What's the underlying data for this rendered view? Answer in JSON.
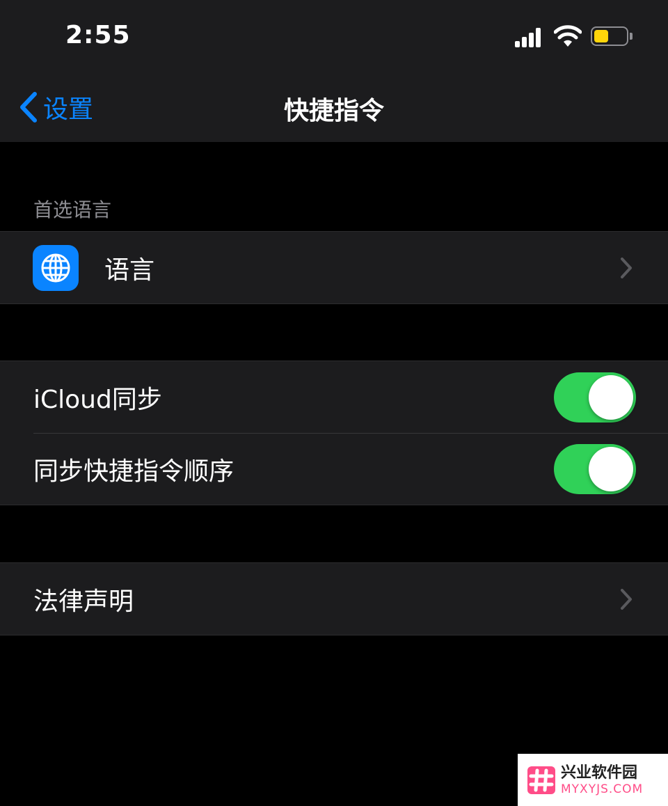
{
  "status_bar": {
    "time": "2:55",
    "battery_fraction": 0.45,
    "battery_color": "#ffd60a"
  },
  "nav": {
    "back_label": "设置",
    "title": "快捷指令",
    "accent": "#0a84ff"
  },
  "sections": {
    "preferred_language": {
      "header": "首选语言",
      "row_label": "语言",
      "icon": "globe-icon"
    },
    "sync": {
      "icloud_label": "iCloud同步",
      "icloud_on": true,
      "order_label": "同步快捷指令顺序",
      "order_on": true,
      "toggle_color": "#30d158"
    },
    "legal": {
      "label": "法律声明"
    }
  },
  "watermark": {
    "name": "兴业软件园",
    "site": "MYXYJS.COM"
  }
}
